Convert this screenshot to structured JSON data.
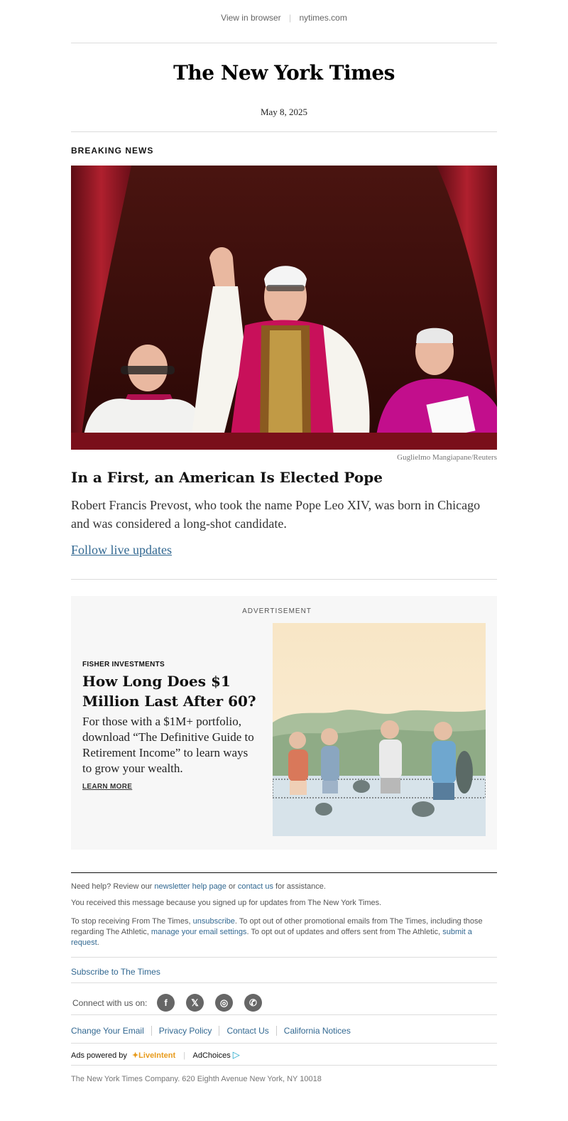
{
  "topbar": {
    "view_in_browser": "View in browser",
    "site": "nytimes.com"
  },
  "masthead": {
    "logo_text": "The New York Times"
  },
  "date": "May 8, 2025",
  "kicker": "BREAKING NEWS",
  "story": {
    "photo_credit": "Guglielmo Mangiapane/Reuters",
    "headline": "In a First, an American Is Elected Pope",
    "summary": "Robert Francis Prevost, who took the name Pope Leo XIV, was born in Chicago and was considered a long-shot candidate.",
    "link_label": "Follow live updates"
  },
  "ad": {
    "label": "ADVERTISEMENT",
    "sponsor": "FISHER INVESTMENTS",
    "headline": "How Long Does $1 Million Last After 60?",
    "body": "For those with a $1M+ portfolio, download “The Definitive Guide to Retirement Income” to learn ways to grow your wealth.",
    "cta": "LEARN MORE"
  },
  "footer": {
    "help_prefix": "Need help? Review our ",
    "help_link1": "newsletter help page",
    "help_or": " or ",
    "help_link2": "contact us",
    "help_suffix": " for assistance.",
    "received": "You received this message because you signed up for updates from The New York Times.",
    "stop_1": "To stop receiving From The Times, ",
    "unsubscribe": "unsubscribe",
    "stop_2": ". To opt out of other promotional emails from The Times, including those regarding The Athletic, ",
    "manage": "manage your email settings",
    "stop_3": ". To opt out of updates and offers sent from The Athletic, ",
    "submit": "submit a request",
    "stop_4": ".",
    "subscribe": "Subscribe to The Times",
    "connect_label": "Connect with us on:",
    "social": [
      {
        "icon": "facebook-icon",
        "glyph": "f"
      },
      {
        "icon": "x-icon",
        "glyph": "𝕏"
      },
      {
        "icon": "instagram-icon",
        "glyph": "◎"
      },
      {
        "icon": "whatsapp-icon",
        "glyph": "✆"
      }
    ],
    "links": [
      "Change Your Email",
      "Privacy Policy",
      "Contact Us",
      "California Notices"
    ],
    "ads_powered": "Ads powered by",
    "liveintent": "LiveIntent",
    "adchoices": "AdChoices",
    "company": "The New York Times Company. 620 Eighth Avenue New York, NY 10018"
  },
  "colors": {
    "link": "#326891",
    "curtain": "#8b1a24",
    "cassock": "#c8105a"
  }
}
